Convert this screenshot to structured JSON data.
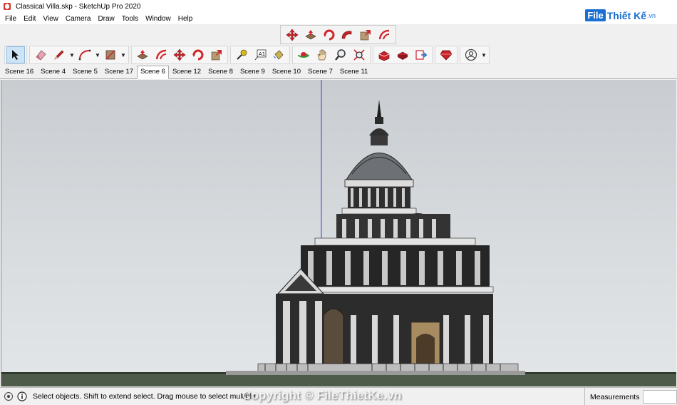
{
  "window": {
    "title": "Classical Villa.skp - SketchUp Pro 2020"
  },
  "menu": [
    "File",
    "Edit",
    "View",
    "Camera",
    "Draw",
    "Tools",
    "Window",
    "Help"
  ],
  "brand": {
    "box": "File",
    "rest": "Thiết Kế",
    "ext": ".vn"
  },
  "float_toolbar": {
    "icons": [
      "move-icon",
      "push-pull-icon",
      "rotate-icon",
      "follow-me-icon",
      "scale-icon",
      "offset-icon"
    ]
  },
  "toolbar": {
    "groups": [
      [
        "select-icon"
      ],
      [
        "eraser-icon",
        "pencil-icon",
        "arc-icon",
        "rectangle-icon"
      ],
      [
        "push-pull-icon",
        "offset-icon",
        "move-icon",
        "rotate-icon",
        "scale-icon"
      ],
      [
        "tape-measure-icon",
        "text-icon",
        "paint-bucket-icon"
      ],
      [
        "orbit-icon",
        "pan-icon",
        "zoom-icon",
        "zoom-extents-icon"
      ],
      [
        "warehouse-icon",
        "extension-warehouse-icon",
        "send-to-layout-icon"
      ],
      [
        "ruby-icon"
      ],
      [
        "account-icon"
      ]
    ]
  },
  "scenes": {
    "tabs": [
      "Scene 16",
      "Scene 4",
      "Scene 5",
      "Scene 17",
      "Scene 6",
      "Scene 12",
      "Scene 8",
      "Scene 9",
      "Scene 10",
      "Scene 7",
      "Scene 11"
    ],
    "active": "Scene 6"
  },
  "status": {
    "message": "Select objects. Shift to extend select. Drag mouse to select multiple.",
    "measurements_label": "Measurements",
    "measurements_value": "",
    "watermark": "Copyright © FileThietKe.vn"
  }
}
